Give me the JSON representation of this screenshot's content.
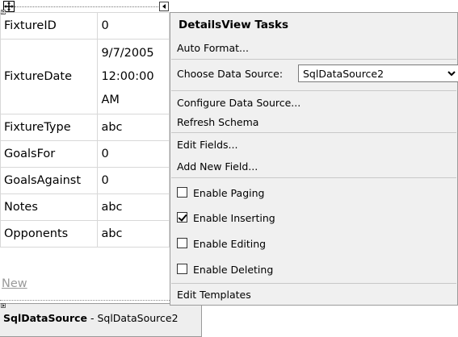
{
  "details_view": {
    "rows": [
      {
        "field": "FixtureID",
        "value": "0"
      },
      {
        "field": "FixtureDate",
        "value_lines": [
          "9/7/2005",
          "12:00:00",
          "AM"
        ]
      },
      {
        "field": "FixtureType",
        "value": "abc"
      },
      {
        "field": "GoalsFor",
        "value": "0"
      },
      {
        "field": "GoalsAgainst",
        "value": "0"
      },
      {
        "field": "Notes",
        "value": "abc"
      },
      {
        "field": "Opponents",
        "value": "abc"
      }
    ],
    "new_link": "New"
  },
  "data_source_control": {
    "type_label": "SqlDataSource",
    "separator": " - ",
    "id": "SqlDataSource2"
  },
  "tasks": {
    "title": "DetailsView Tasks",
    "auto_format": "Auto Format...",
    "choose_data_source_label": "Choose Data Source:",
    "choose_data_source_value": "SqlDataSource2",
    "configure_data_source": "Configure Data Source...",
    "refresh_schema": "Refresh Schema",
    "edit_fields": "Edit Fields...",
    "add_new_field": "Add New Field...",
    "enable_paging": {
      "label": "Enable Paging",
      "checked": false
    },
    "enable_inserting": {
      "label": "Enable Inserting",
      "checked": true
    },
    "enable_editing": {
      "label": "Enable Editing",
      "checked": false
    },
    "enable_deleting": {
      "label": "Enable Deleting",
      "checked": false
    },
    "edit_templates": "Edit Templates"
  }
}
